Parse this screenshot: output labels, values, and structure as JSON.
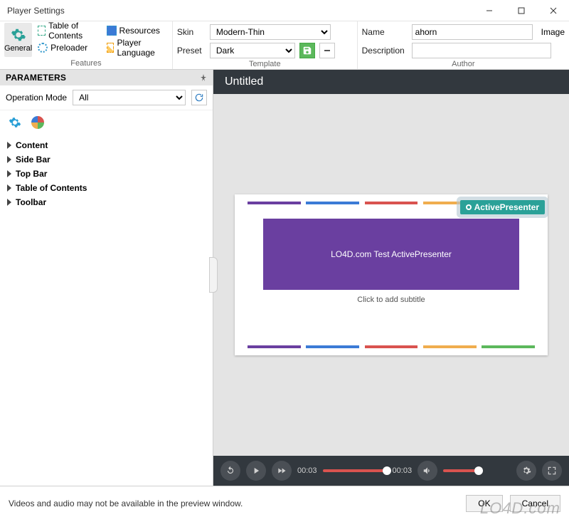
{
  "titlebar": {
    "title": "Player Settings"
  },
  "ribbon": {
    "features": {
      "label": "Features",
      "general": "General",
      "toc": "Table of Contents",
      "resources": "Resources",
      "preloader": "Preloader",
      "player_language": "Player Language"
    },
    "template": {
      "label": "Template",
      "skin_label": "Skin",
      "skin_value": "Modern-Thin",
      "preset_label": "Preset",
      "preset_value": "Dark"
    },
    "author": {
      "label": "Author",
      "name_label": "Name",
      "name_value": "ahorn",
      "image_label": "Image",
      "desc_label": "Description",
      "desc_value": ""
    }
  },
  "left": {
    "parameters": "PARAMETERS",
    "opmode_label": "Operation Mode",
    "opmode_value": "All",
    "tree": [
      "Content",
      "Side Bar",
      "Top Bar",
      "Table of Contents",
      "Toolbar"
    ]
  },
  "preview": {
    "title": "Untitled",
    "slide_title": "LO4D.com Test ActivePresenter",
    "subtitle_placeholder": "Click to add subtitle",
    "tag": "ActivePresenter"
  },
  "player": {
    "elapsed": "00:03",
    "total": "00:03"
  },
  "footer": {
    "msg": "Videos and audio may not be available in the preview window.",
    "ok": "OK",
    "cancel": "Cancel"
  },
  "watermark": "LO4D.com"
}
